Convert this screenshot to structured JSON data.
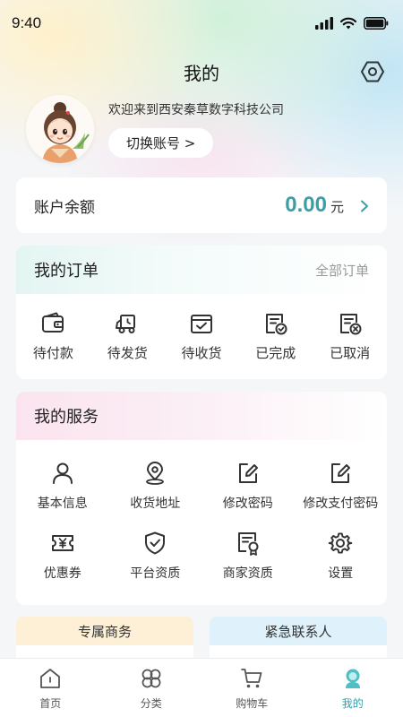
{
  "status_bar": {
    "time": "9:40"
  },
  "header": {
    "title": "我的"
  },
  "profile": {
    "welcome_text": "欢迎来到西安秦草数字科技公司",
    "switch_account_label": "切换账号 >"
  },
  "balance": {
    "label": "账户余额",
    "amount": "0.00",
    "unit": "元"
  },
  "orders": {
    "title": "我的订单",
    "all_link": "全部订单",
    "items": [
      {
        "label": "待付款",
        "icon": "wallet-icon"
      },
      {
        "label": "待发货",
        "icon": "delivery-truck-icon"
      },
      {
        "label": "待收货",
        "icon": "receive-box-icon"
      },
      {
        "label": "已完成",
        "icon": "document-check-icon"
      },
      {
        "label": "已取消",
        "icon": "document-cancel-icon"
      }
    ]
  },
  "services": {
    "title": "我的服务",
    "items": [
      {
        "label": "基本信息",
        "icon": "user-icon"
      },
      {
        "label": "收货地址",
        "icon": "location-pin-icon"
      },
      {
        "label": "修改密码",
        "icon": "edit-icon"
      },
      {
        "label": "修改支付密码",
        "icon": "edit-icon"
      },
      {
        "label": "优惠券",
        "icon": "coupon-icon"
      },
      {
        "label": "平台资质",
        "icon": "shield-check-icon"
      },
      {
        "label": "商家资质",
        "icon": "certificate-icon"
      },
      {
        "label": "设置",
        "icon": "gear-icon"
      }
    ]
  },
  "bottom_cards": {
    "exclusive_business": "专属商务",
    "emergency_contact": "紧急联系人"
  },
  "tabbar": {
    "active": "我的",
    "items": [
      {
        "label": "首页",
        "icon": "home-icon"
      },
      {
        "label": "分类",
        "icon": "category-icon"
      },
      {
        "label": "购物车",
        "icon": "cart-icon"
      },
      {
        "label": "我的",
        "icon": "profile-icon"
      }
    ]
  },
  "colors": {
    "accent": "#3a9fa5",
    "tab_active": "#2e9fb0",
    "orders_header": "#e3f5f2",
    "services_header": "#fbe4ef",
    "exclusive_header": "#fdf0d6",
    "emergency_header": "#dff1fa"
  }
}
